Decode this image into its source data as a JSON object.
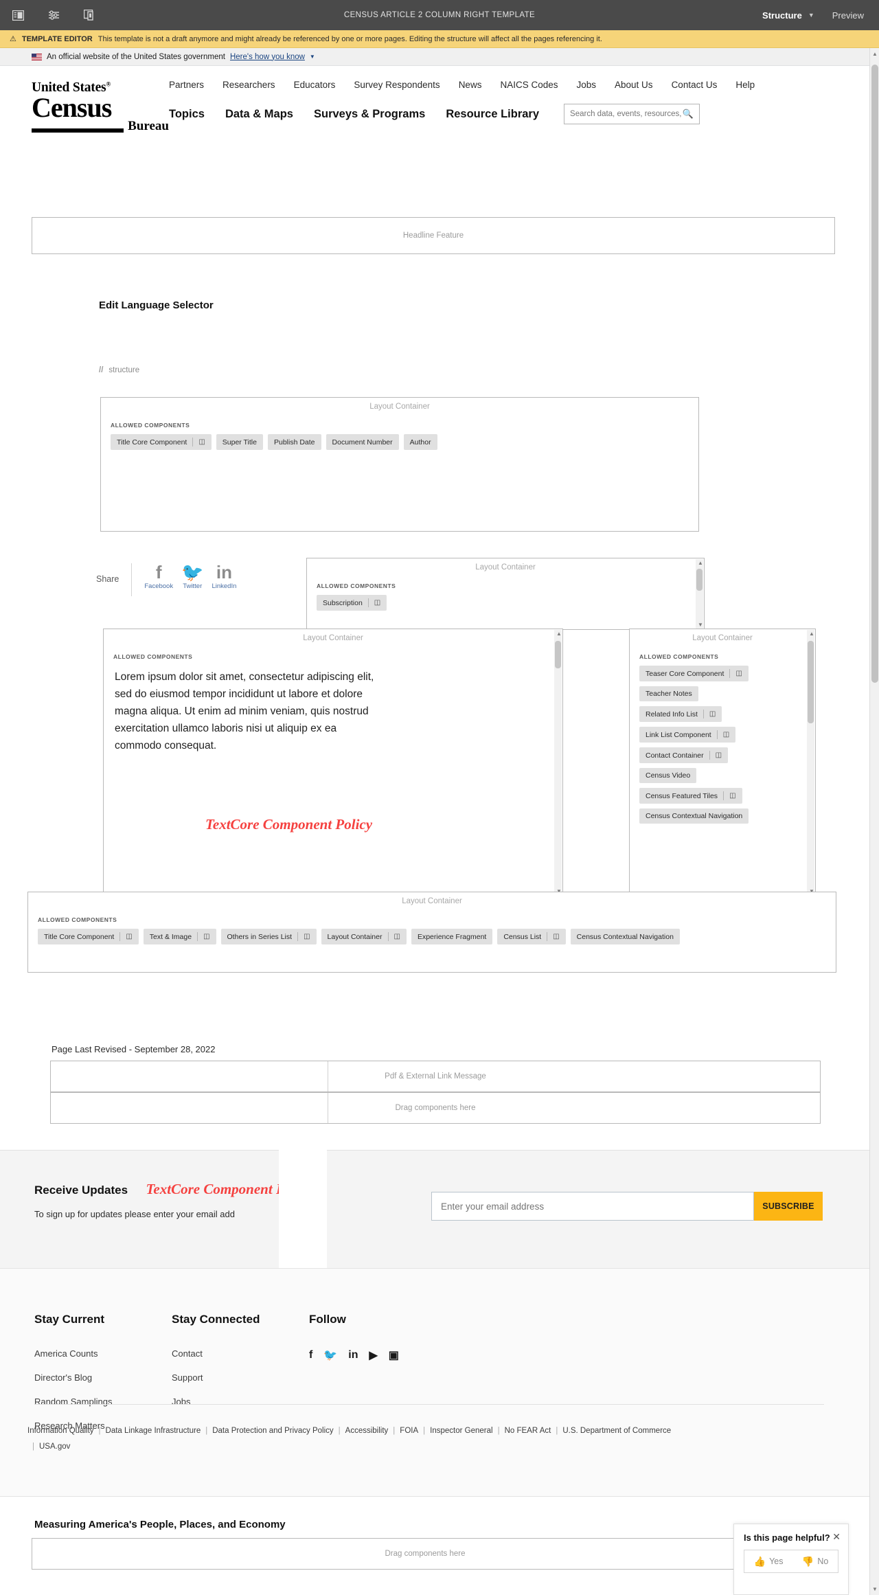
{
  "aem": {
    "title": "CENSUS ARTICLE 2 COLUMN RIGHT TEMPLATE",
    "icons": {
      "sidebar": "sidebar-panel-icon",
      "settings": "settings-sliders-icon",
      "emulator": "device-emulator-icon"
    },
    "mode_label": "Structure",
    "preview_label": "Preview",
    "banner": {
      "warning_icon": "⚠",
      "label": "TEMPLATE EDITOR",
      "text": "This template is not a draft anymore and might already be referenced by one or more pages. Editing the structure will affect all the pages referencing it."
    }
  },
  "usgov": {
    "text": "An official website of the United States government",
    "link": "Here's how you know"
  },
  "census_header": {
    "logo": {
      "line1": "United States",
      "registered": "®",
      "line2": "Census",
      "line3": "Bureau"
    },
    "utility_nav": [
      "Partners",
      "Researchers",
      "Educators",
      "Survey Respondents",
      "News",
      "NAICS Codes",
      "Jobs",
      "About Us",
      "Contact Us",
      "Help"
    ],
    "main_nav": [
      "Topics",
      "Data & Maps",
      "Surveys & Programs",
      "Resource Library"
    ],
    "search_placeholder": "Search data, events, resources, an..."
  },
  "canvas": {
    "headline_feature": "Headline Feature",
    "edit_language_selector": "Edit Language Selector",
    "structure_path": {
      "slashes": "//",
      "label": "structure"
    },
    "layout_container_label": "Layout Container",
    "allowed_components_label": "ALLOWED COMPONENTS",
    "title_container_chips": [
      {
        "label": "Title Core Component",
        "has_policy_icon": true
      },
      {
        "label": "Super Title",
        "has_policy_icon": false
      },
      {
        "label": "Publish Date",
        "has_policy_icon": false
      },
      {
        "label": "Document Number",
        "has_policy_icon": false
      },
      {
        "label": "Author",
        "has_policy_icon": false
      }
    ],
    "share": {
      "label": "Share",
      "items": [
        {
          "icon": "facebook-icon",
          "glyph": "f",
          "name": "Facebook"
        },
        {
          "icon": "twitter-icon",
          "glyph": "🐦",
          "name": "Twitter"
        },
        {
          "icon": "linkedin-icon",
          "glyph": "in",
          "name": "LinkedIn"
        }
      ]
    },
    "subscription_container_chips": [
      {
        "label": "Subscription",
        "has_policy_icon": true
      }
    ],
    "main_container": {
      "lorem": "Lorem ipsum dolor sit amet, consectetur adipiscing elit, sed do eiusmod tempor incididunt ut labore et dolore magna aliqua. Ut enim ad minim veniam, quis nostrud exercitation ullamco laboris nisi ut aliquip ex ea commodo consequat.",
      "policy_text": "TextCore Component Policy"
    },
    "right_container_chips": [
      {
        "label": "Teaser Core Component",
        "has_policy_icon": true
      },
      {
        "label": "Teacher Notes",
        "has_policy_icon": false
      },
      {
        "label": "Related Info List",
        "has_policy_icon": true
      },
      {
        "label": "Link List Component",
        "has_policy_icon": true
      },
      {
        "label": "Contact Container",
        "has_policy_icon": true
      },
      {
        "label": "Census Video",
        "has_policy_icon": false
      },
      {
        "label": "Census Featured Tiles",
        "has_policy_icon": true
      },
      {
        "label": "Census Contextual Navigation",
        "has_policy_icon": false
      }
    ],
    "bottom_container_chips": [
      {
        "label": "Title Core Component",
        "has_policy_icon": true
      },
      {
        "label": "Text & Image",
        "has_policy_icon": true
      },
      {
        "label": "Others in Series List",
        "has_policy_icon": true
      },
      {
        "label": "Layout Container",
        "has_policy_icon": true
      },
      {
        "label": "Experience Fragment",
        "has_policy_icon": false
      },
      {
        "label": "Census List",
        "has_policy_icon": true
      },
      {
        "label": "Census Contextual Navigation",
        "has_policy_icon": false
      }
    ],
    "page_last_revised": "Page Last Revised - September 28, 2022",
    "pdf_external_link_message": "Pdf & External Link Message",
    "drag_components_here": "Drag components here"
  },
  "updates": {
    "heading": "Receive Updates",
    "policy_text": "TextCore Component Policy",
    "subtext": "To sign up for updates please enter your email add",
    "email_placeholder": "Enter your email address",
    "subscribe_label": "SUBSCRIBE",
    "accent_color": "#fcb514"
  },
  "footer": {
    "columns": [
      {
        "heading": "Stay Current",
        "links": [
          "America Counts",
          "Director's Blog",
          "Random Samplings",
          "Research Matters"
        ]
      },
      {
        "heading": "Stay Connected",
        "links": [
          "Contact",
          "Support",
          "Jobs"
        ]
      }
    ],
    "follow_heading": "Follow",
    "social": [
      {
        "icon": "facebook-icon",
        "glyph": "f"
      },
      {
        "icon": "twitter-icon",
        "glyph": "🐦"
      },
      {
        "icon": "linkedin-icon",
        "glyph": "in"
      },
      {
        "icon": "youtube-icon",
        "glyph": "▶"
      },
      {
        "icon": "instagram-icon",
        "glyph": "▣"
      }
    ],
    "legal_links": [
      "Information Quality",
      "Data Linkage Infrastructure",
      "Data Protection and Privacy Policy",
      "Accessibility",
      "FOIA",
      "Inspector General",
      "No FEAR Act",
      "U.S. Department of Commerce",
      "USA.gov"
    ],
    "measuring": "Measuring America's People, Places, and Economy",
    "drag_components_here": "Drag components here"
  },
  "feedback": {
    "title": "Is this page helpful?",
    "close_icon": "✕",
    "yes_label": "Yes",
    "no_label": "No",
    "thumbs_up_icon": "👍",
    "thumbs_down_icon": "👎"
  }
}
